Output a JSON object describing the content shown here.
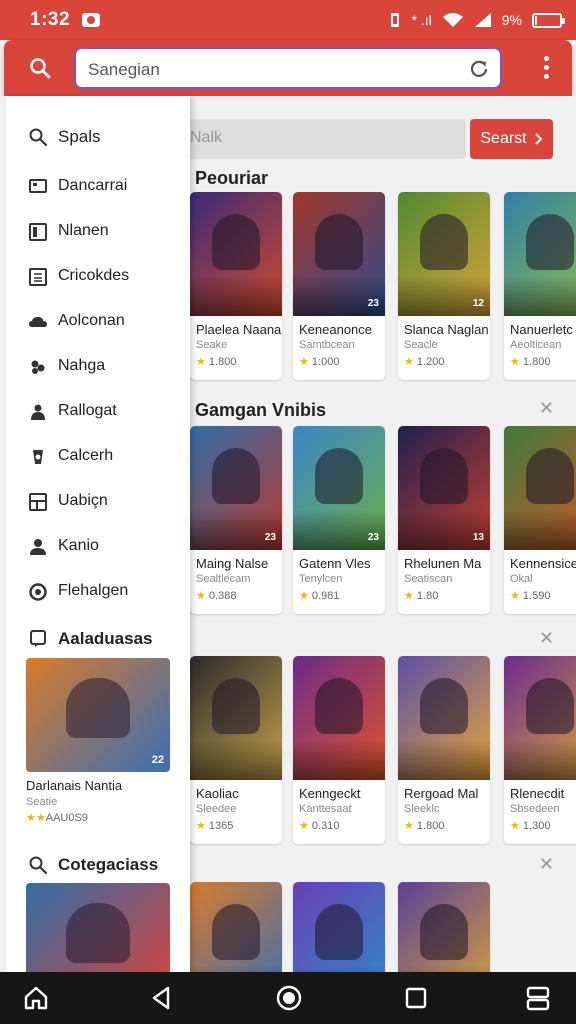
{
  "status": {
    "time": "1:32",
    "network": "* .ıl",
    "battery": "9%",
    "battery_level": 0.09
  },
  "toolbar": {
    "url_text": "Sanegian"
  },
  "main": {
    "search_placeholder": "Nalk",
    "search_button": "Searst",
    "sections": [
      {
        "title": "Peouriar",
        "cards": [
          {
            "title": "Plaelea Naana",
            "sub": "Seake",
            "rating": "1.800",
            "badge": "",
            "colors": [
              "#3a2a7a",
              "#d24a2a"
            ]
          },
          {
            "title": "Keneanonce",
            "sub": "Samtbcean",
            "rating": "1:000",
            "badge": "23",
            "colors": [
              "#a1362a",
              "#2f4c8c"
            ]
          },
          {
            "title": "Slanca Naglan",
            "sub": "Seacle",
            "rating": "1.200",
            "badge": "12",
            "colors": [
              "#4f8a2f",
              "#d9a33a"
            ]
          },
          {
            "title": "Nanuerletc",
            "sub": "Aeolticean",
            "rating": "1.800",
            "badge": "",
            "colors": [
              "#2f7fa9",
              "#8fbd4b"
            ]
          }
        ]
      },
      {
        "title": "Gamgan Vnibis",
        "cards": [
          {
            "title": "Maing Nalse",
            "sub": "Sealtlecam",
            "rating": "0.388",
            "badge": "23",
            "colors": [
              "#2f6ea8",
              "#b93a2f"
            ]
          },
          {
            "title": "Gatenn Vles",
            "sub": "Tenylcen",
            "rating": "0.981",
            "badge": "23",
            "colors": [
              "#3b86c9",
              "#6bb04a"
            ]
          },
          {
            "title": "Rhelunen Ma",
            "sub": "Seatiscan",
            "rating": "1.80",
            "badge": "13",
            "colors": [
              "#1f1f4f",
              "#c4402f"
            ]
          },
          {
            "title": "Kennensice",
            "sub": "Okal",
            "rating": "1.590",
            "badge": "",
            "colors": [
              "#3f7a3a",
              "#c95a2a"
            ]
          }
        ]
      },
      {
        "title": "",
        "cards": [
          {
            "title": "Kaoliac",
            "sub": "Sleedee",
            "rating": "1365",
            "badge": "",
            "colors": [
              "#2a2a2a",
              "#c5a34a"
            ]
          },
          {
            "title": "Kenngeckt",
            "sub": "Kanttesaat",
            "rating": "0.310",
            "badge": "",
            "colors": [
              "#6a2a8a",
              "#e2542a"
            ]
          },
          {
            "title": "Rergoad Mal",
            "sub": "Sleeklc",
            "rating": "1.800",
            "badge": "",
            "colors": [
              "#5a4fa8",
              "#e9a23a"
            ]
          },
          {
            "title": "Rlenecdit",
            "sub": "Sbsedeen",
            "rating": "1.300",
            "badge": "",
            "colors": [
              "#6b2a8f",
              "#d9a33a"
            ]
          }
        ]
      },
      {
        "title": "",
        "cards": [
          {
            "title": "",
            "sub": "",
            "rating": "",
            "badge": "",
            "colors": [
              "#d97a2a",
              "#3a6fb5"
            ]
          },
          {
            "title": "",
            "sub": "",
            "rating": "",
            "badge": "",
            "colors": [
              "#6a3fb5",
              "#2f8ac9"
            ]
          },
          {
            "title": "",
            "sub": "",
            "rating": "",
            "badge": "",
            "colors": [
              "#5a3f9a",
              "#d9a33a"
            ]
          }
        ]
      }
    ]
  },
  "drawer": {
    "header_label": "Spals",
    "items": [
      {
        "label": "Dancarrai",
        "icon": "monitor-icon"
      },
      {
        "label": "Nlanen",
        "icon": "window-icon"
      },
      {
        "label": "Cricokdes",
        "icon": "calendar-icon"
      },
      {
        "label": "Aolconan",
        "icon": "cloud-icon"
      },
      {
        "label": "Nahga",
        "icon": "group-icon"
      },
      {
        "label": "Rallogat",
        "icon": "people-icon"
      },
      {
        "label": "Calcerh",
        "icon": "badge-icon"
      },
      {
        "label": "Uabiçn",
        "icon": "grid-icon"
      },
      {
        "label": "Kanio",
        "icon": "person-icon"
      },
      {
        "label": "Flehalgen",
        "icon": "circle-icon"
      }
    ],
    "section_downloads": "Aaladuasas",
    "featured": {
      "title": "Darlanais Nantia",
      "sub": "Seatie",
      "rating": "AAU0S9",
      "badge": "22",
      "colors": [
        "#d97a2a",
        "#3a6fb5"
      ]
    },
    "section_categories": "Cotegaciass",
    "featured2": {
      "colors": [
        "#2f6ea8",
        "#d9433a"
      ]
    }
  }
}
